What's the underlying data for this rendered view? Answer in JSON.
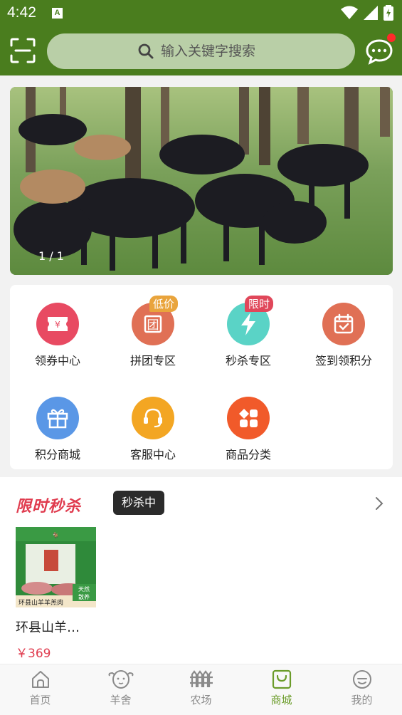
{
  "status_bar": {
    "time": "4:42",
    "notif_letter": "A"
  },
  "header": {
    "search_placeholder": "输入关键字搜索"
  },
  "banner": {
    "counter": "1 / 1"
  },
  "grid": {
    "items": [
      {
        "label": "领券中心",
        "icon": "coupon-icon",
        "color": "#e84a62"
      },
      {
        "label": "拼团专区",
        "icon": "group-buy-icon",
        "color": "#e07055",
        "badge": "低价",
        "badge_color": "#e9a43c"
      },
      {
        "label": "秒杀专区",
        "icon": "lightning-icon",
        "color": "#5ad3c6",
        "badge": "限时",
        "badge_color": "#e0475a"
      },
      {
        "label": "签到领积分",
        "icon": "calendar-icon",
        "color": "#e07055"
      },
      {
        "label": "积分商城",
        "icon": "gift-icon",
        "color": "#5a97e6"
      },
      {
        "label": "客服中心",
        "icon": "headset-icon",
        "color": "#f3a623"
      },
      {
        "label": "商品分类",
        "icon": "category-icon",
        "color": "#f15a2a"
      }
    ]
  },
  "flash_sale": {
    "title": "限时秒杀",
    "state": "秒杀中",
    "product": {
      "name": "环县山羊…",
      "price": "￥369",
      "img_caption": "环县山羊羊羔肉",
      "img_tag": "天然散养"
    }
  },
  "tabbar": {
    "tabs": [
      {
        "label": "首页",
        "icon": "home-icon"
      },
      {
        "label": "羊舍",
        "icon": "sheep-icon"
      },
      {
        "label": "农场",
        "icon": "farm-icon"
      },
      {
        "label": "商城",
        "icon": "shopping-bag-icon",
        "active": true
      },
      {
        "label": "我的",
        "icon": "profile-icon"
      }
    ]
  },
  "colors": {
    "brand_green": "#4a7d1e",
    "accent_red": "#e03c4f",
    "active_tab": "#6b9c2a"
  }
}
